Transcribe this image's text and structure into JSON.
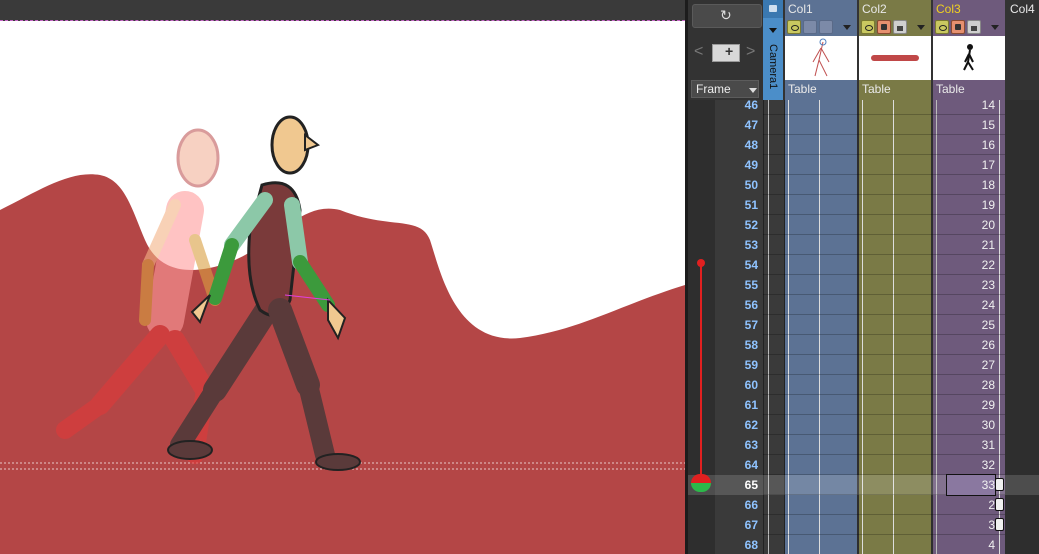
{
  "header": {
    "frame_mode": "Frame",
    "camera_column_label": "Camera1"
  },
  "columns": [
    {
      "name": "Col1",
      "level": "Table"
    },
    {
      "name": "Col2",
      "level": "Table"
    },
    {
      "name": "Col3",
      "level": "Table"
    },
    {
      "name": "Col4",
      "level": ""
    }
  ],
  "frames": [
    "46",
    "47",
    "48",
    "49",
    "50",
    "51",
    "52",
    "53",
    "54",
    "55",
    "56",
    "57",
    "58",
    "59",
    "60",
    "61",
    "62",
    "63",
    "64",
    "65",
    "66",
    "67",
    "68"
  ],
  "current_frame": "65",
  "col3_cells": [
    "14",
    "15",
    "16",
    "17",
    "18",
    "19",
    "20",
    "21",
    "22",
    "23",
    "24",
    "25",
    "26",
    "27",
    "28",
    "29",
    "30",
    "31",
    "32",
    "33",
    "2",
    "3",
    "4"
  ],
  "colors": {
    "col1": "#5c7294",
    "col2": "#7a7a46",
    "col3": "#6e5a7c",
    "hills": "#b44646",
    "frame_number": "#8fc3ff",
    "playhead": "#e02020"
  },
  "icons": {
    "viewer_toggle": "rotate-icon",
    "new_level": "new-level-icon",
    "lock": "lock-icon",
    "preview": "eye-icon",
    "camstand": "camstand-icon",
    "key": "key-icon"
  }
}
